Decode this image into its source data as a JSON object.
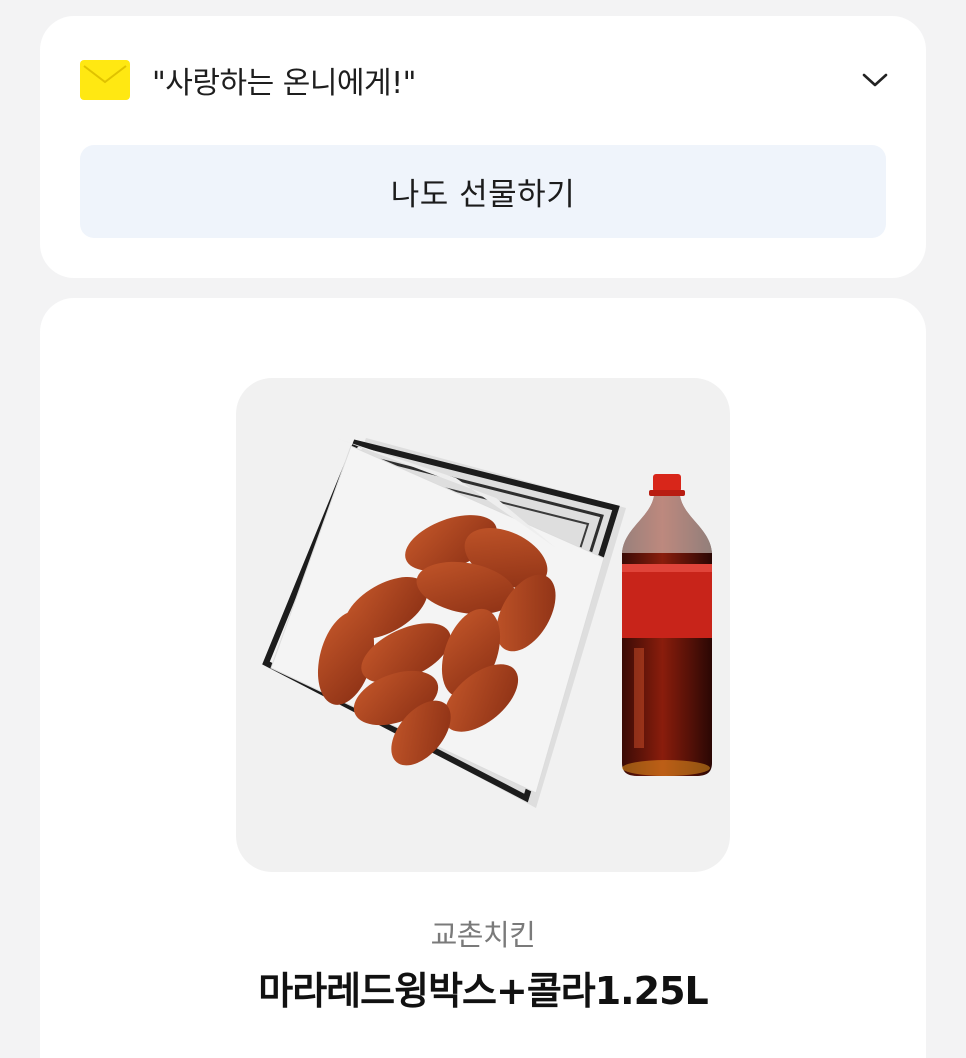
{
  "gift_message": {
    "icon": "envelope-icon",
    "text": "\"사랑하는 온니에게!\"",
    "toggle_icon": "chevron-down-icon"
  },
  "gift_button": {
    "label": "나도 선물하기"
  },
  "product": {
    "image": "fried-chicken-wings-basket-and-cola-bottle",
    "brand": "교촌치킨",
    "name": "마라레드윙박스+콜라1.25L"
  },
  "colors": {
    "background": "#f3f3f4",
    "card": "#ffffff",
    "envelope": "#ffe812",
    "button_bg": "#eff4fb"
  }
}
